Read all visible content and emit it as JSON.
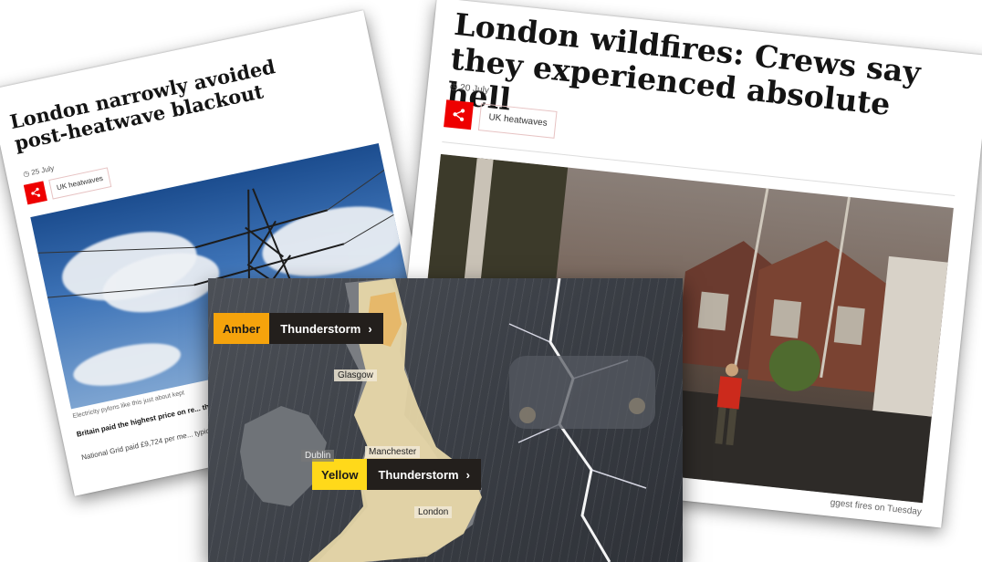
{
  "left_article": {
    "headline": "London narrowly avoided post-heatwave blackout",
    "date": "25 July",
    "topic": "UK heatwaves",
    "caption": "Electricity pylons like this just about kept",
    "lede": "Britain paid the highest price on re... the capital narrowly avoided a po...",
    "body": "National Grid paid £9,724 per me... typical price, to Belgium on Wed... power."
  },
  "right_article": {
    "headline": "London wildfires: Crews say they experienced absolute hell",
    "date": "20 July",
    "topic": "UK heatwaves",
    "caption": "ggest fires on Tuesday"
  },
  "weather_map": {
    "alerts": [
      {
        "level": "Amber",
        "type": "Thunderstorm",
        "color": "#f5a30c"
      },
      {
        "level": "Yellow",
        "type": "Thunderstorm",
        "color": "#ffd91a"
      }
    ],
    "places": {
      "glasgow": "Glasgow",
      "manchester": "Manchester",
      "dublin": "Dublin",
      "london": "London"
    }
  },
  "colors": {
    "share_red": "#ee0000",
    "map_yellow_zone": "#e9d9a9",
    "map_amber_zone": "#e6b86a"
  },
  "icons": [
    "share-icon",
    "clock-icon",
    "chevron-right-icon"
  ]
}
